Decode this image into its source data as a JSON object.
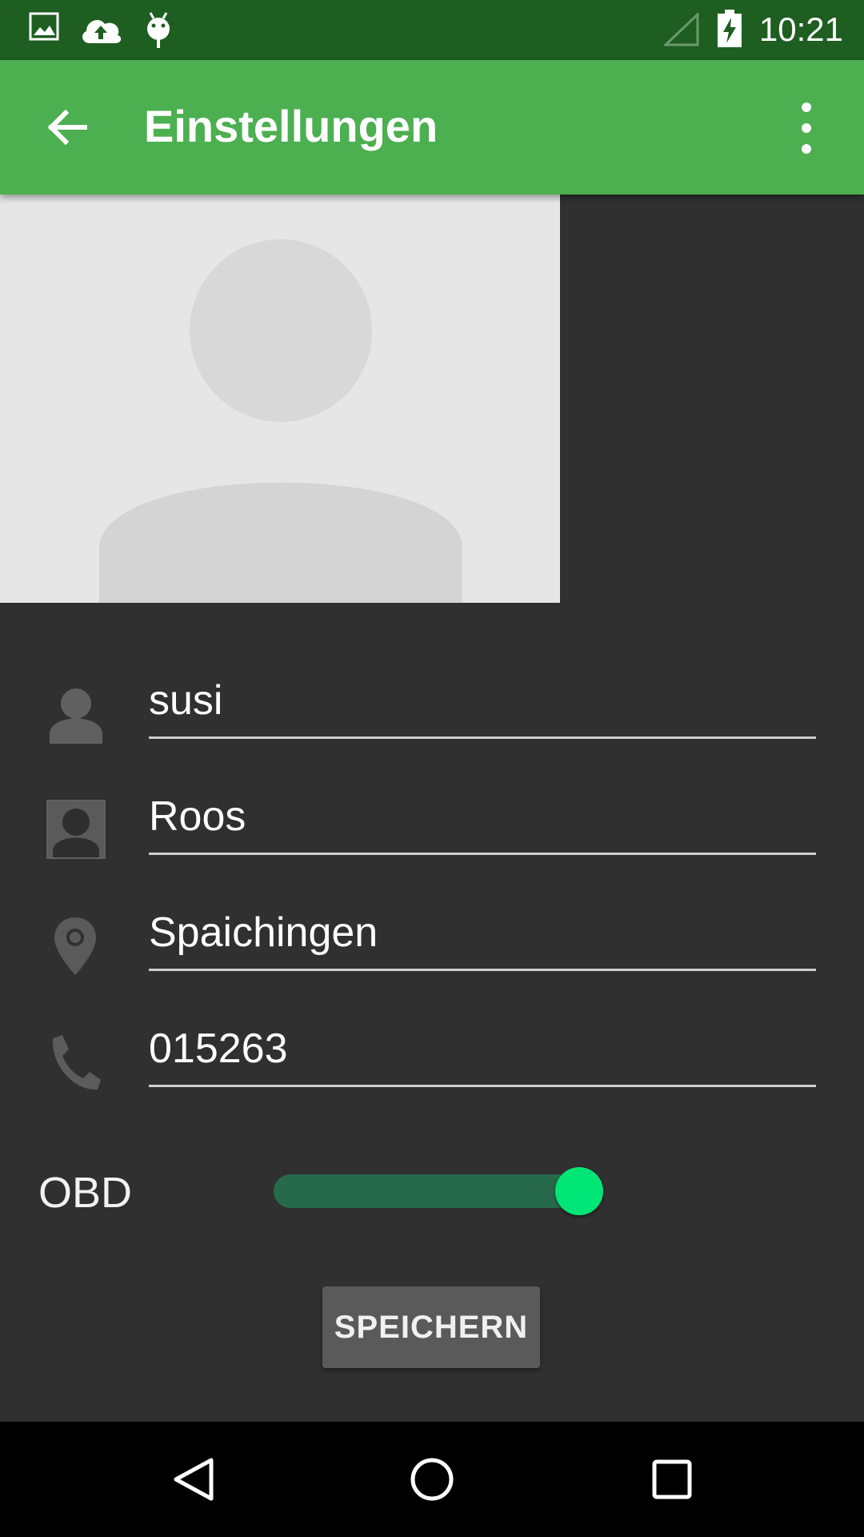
{
  "status_bar": {
    "time": "10:21",
    "icons": [
      "image-icon",
      "cloud-upload-icon",
      "android-debug-icon",
      "signal-icon",
      "battery-charging-icon"
    ]
  },
  "app_bar": {
    "title": "Einstellungen",
    "back_icon": "arrow-back-icon",
    "menu_icon": "more-vert-icon",
    "color": "#4caf50"
  },
  "profile": {
    "avatar_icon": "person-placeholder-icon"
  },
  "fields": [
    {
      "icon": "person-icon",
      "value": "susi"
    },
    {
      "icon": "contact-icon",
      "value": "Roos"
    },
    {
      "icon": "location-pin-icon",
      "value": "Spaichingen"
    },
    {
      "icon": "phone-icon",
      "value": "015263"
    }
  ],
  "obd": {
    "label": "OBD",
    "enabled": true,
    "accent": "#00e676"
  },
  "save_button": {
    "label": "SPEICHERN"
  },
  "nav_bar": {
    "icons": [
      "back-triangle-icon",
      "home-circle-icon",
      "recents-square-icon"
    ]
  },
  "colors": {
    "status_bar": "#1e5e21",
    "background": "#303030",
    "toolbar": "#4caf50"
  }
}
